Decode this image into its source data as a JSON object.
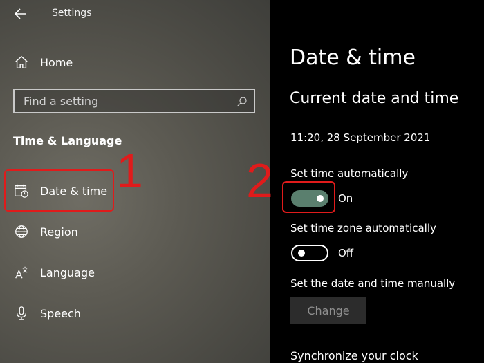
{
  "app": {
    "title": "Settings"
  },
  "nav": {
    "home": "Home",
    "search_placeholder": "Find a setting",
    "section": "Time & Language",
    "items": [
      {
        "label": "Date & time",
        "icon": "calendar-clock-icon"
      },
      {
        "label": "Region",
        "icon": "globe-icon"
      },
      {
        "label": "Language",
        "icon": "language-icon"
      },
      {
        "label": "Speech",
        "icon": "microphone-icon"
      }
    ]
  },
  "main": {
    "title": "Date & time",
    "subtitle": "Current date and time",
    "current_datetime": "11:20, 28 September 2021",
    "set_time_auto": {
      "label": "Set time automatically",
      "state": "On"
    },
    "set_timezone_auto": {
      "label": "Set time zone automatically",
      "state": "Off"
    },
    "manual": {
      "label": "Set the date and time manually",
      "button": "Change"
    },
    "sync": {
      "label": "Synchronize your clock"
    }
  },
  "annotations": {
    "step1": "1",
    "step2": "2",
    "color": "#e01b1b"
  }
}
